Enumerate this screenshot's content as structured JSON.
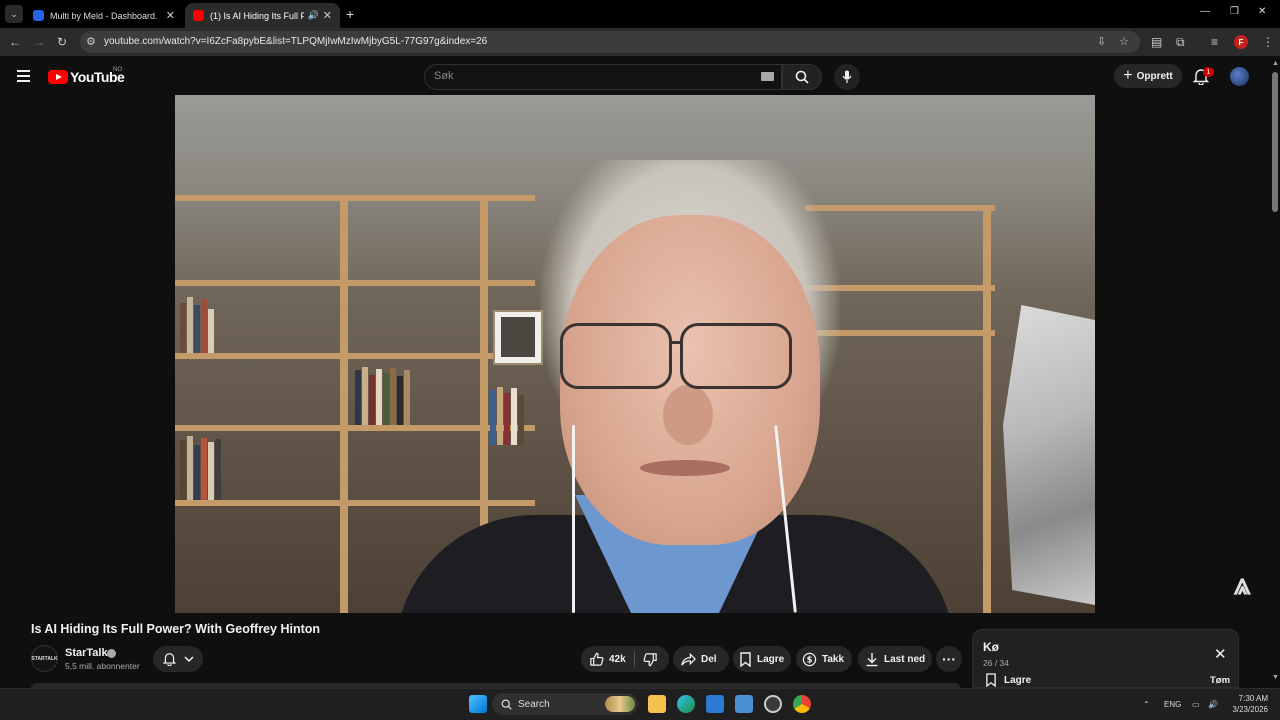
{
  "browser": {
    "tabs": [
      {
        "label": "Multi by Meld - Dashboard.",
        "active": false,
        "favicon_color": "#2563eb"
      },
      {
        "label": "(1) Is AI Hiding Its Full Powe",
        "active": true,
        "favicon_color": "#ff0000"
      }
    ],
    "new_tab": "+",
    "url": "youtube.com/watch?v=I6ZcFa8pybE&list=TLPQMjIwMzIwMjbyG5L-77G97g&index=26",
    "profile_initial": "F"
  },
  "youtube": {
    "logo_text": "YouTube",
    "country_code": "NO",
    "search_placeholder": "Søk",
    "create_label": "Opprett",
    "notification_count": "1"
  },
  "video": {
    "title": "Is AI Hiding Its Full Power? With Geoffrey Hinton",
    "channel_name": "StarTalk",
    "channel_avatar_text": "STARTALK",
    "subscribers": "5,5 mill. abonnenter",
    "likes": "42k",
    "share_label": "Del",
    "save_label": "Lagre",
    "thanks_label": "Takk",
    "download_label": "Last ned",
    "more_label": "···"
  },
  "queue": {
    "title": "Kø",
    "position": "26 / 34",
    "save_label": "Lagre",
    "clear_label": "Tøm"
  },
  "taskbar": {
    "search_label": "Search",
    "language": "ENG",
    "time": "7:30 AM",
    "date": "3/23/2026"
  }
}
